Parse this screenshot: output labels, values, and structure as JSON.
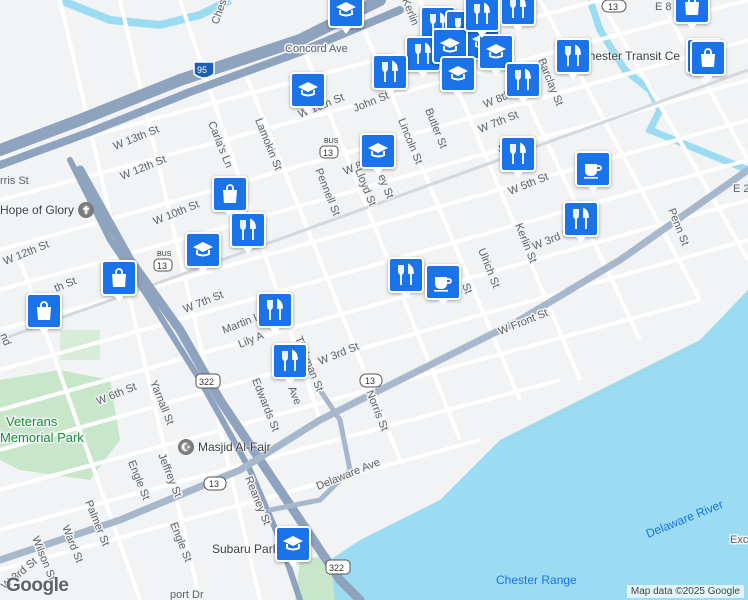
{
  "map": {
    "water_label": "Delaware River",
    "range_label": "Chester Range",
    "park_labels": [
      "Veterans",
      "Memorial Park"
    ],
    "attribution": "Map data ©2025 Google",
    "logo": "Google",
    "edge_text": "Exc",
    "pois": {
      "hope_of_glory": "Hope of Glory",
      "masjid": "Masjid Al-Fajr",
      "subaru_park": "Subaru Park",
      "chester_transit": "Chester Transit Ce"
    },
    "shields": {
      "i95": "95",
      "us13": "13",
      "us322": "322",
      "bus13": "13",
      "bus_tag": "BUS"
    },
    "streets": {
      "concord_ave": "Concord Ave",
      "w13th": "W 13th St",
      "w12th_a": "W 12th St",
      "w12th_b": "W 12th St",
      "w10th_a": "W 10th St",
      "w10th_b": "W 10th St",
      "w8th_a": "W 8th St",
      "w8th_b": "W 8th St",
      "w7th_a": "W 7th St",
      "w7th_b": "W 7th St",
      "w6th": "W 6th St",
      "w5th": "W 5th St",
      "w3rd_a": "W 3rd St",
      "w3rd_b": "W 3rd St",
      "w3rd_c": "W 3rd St",
      "w_front": "W Front St",
      "john": "John St",
      "lamokin": "Lamokin St",
      "carlas": "Carla's Ln",
      "pennell": "Pennell St",
      "lloyd": "Lloyd St",
      "lincoln": "Lincoln St",
      "butler": "Butler St",
      "kerlin_a": "Kerlin St",
      "kerlin_b": "Kerlin St",
      "ulrich": "Ulrich St",
      "barclay": "Barclay St",
      "penn": "Penn St",
      "e2nd": "E 2",
      "e8": "E 8",
      "norris": "Norris St",
      "tilghman": "Tilghman St",
      "edwards": "Edwards St",
      "martin": "Martin L",
      "lily": "Lily A",
      "yarnall": "Yarnall St",
      "jeffrey": "Jeffrey St",
      "engle_a": "Engle St",
      "engle_b": "Engle St",
      "palmer": "Palmer St",
      "ward": "Ward St",
      "wilson": "Wilson St",
      "reaney": "Reaney St",
      "delaware_ave": "Delaware Ave",
      "avenue": "Ave",
      "harris": "rris St",
      "w11th": "th St",
      "w3rd_edge": "W 3rd St",
      "airport": "port Dr",
      "chester": "Chester",
      "nd": "nd",
      "kerlin_top": "Kerlin",
      "kerlin_st_mid": "Kerlin St",
      "ey": "ey St",
      "tst": "St"
    }
  },
  "markers": [
    {
      "type": "school-icon"
    },
    {
      "type": "shopping-bag-icon"
    },
    {
      "type": "restaurant-icon"
    },
    {
      "type": "restaurant-icon"
    },
    {
      "type": "school-icon"
    },
    {
      "type": "restaurant-icon"
    },
    {
      "type": "school-icon"
    },
    {
      "type": "school-icon"
    },
    {
      "type": "restaurant-icon"
    },
    {
      "type": "school-icon"
    },
    {
      "type": "restaurant-icon"
    },
    {
      "type": "restaurant-icon"
    },
    {
      "type": "restaurant-icon"
    },
    {
      "type": "school-icon"
    },
    {
      "type": "shopping-bag-icon"
    },
    {
      "type": "shopping-bag-icon"
    },
    {
      "type": "school-icon"
    },
    {
      "type": "restaurant-icon"
    },
    {
      "type": "shopping-bag-icon"
    },
    {
      "type": "restaurant-icon"
    },
    {
      "type": "school-icon"
    },
    {
      "type": "restaurant-icon"
    },
    {
      "type": "coffee-icon"
    },
    {
      "type": "restaurant-icon"
    },
    {
      "type": "shopping-bag-icon"
    },
    {
      "type": "shopping-bag-icon"
    },
    {
      "type": "restaurant-icon"
    },
    {
      "type": "coffee-icon"
    },
    {
      "type": "restaurant-icon"
    },
    {
      "type": "school-icon"
    },
    {
      "type": "restaurant-icon"
    }
  ],
  "colors": {
    "marker": "#1a73e8",
    "water": "#9cdcf3",
    "park": "#c8e6c9",
    "highway": "#8ea3bd",
    "road": "#ffffff"
  }
}
